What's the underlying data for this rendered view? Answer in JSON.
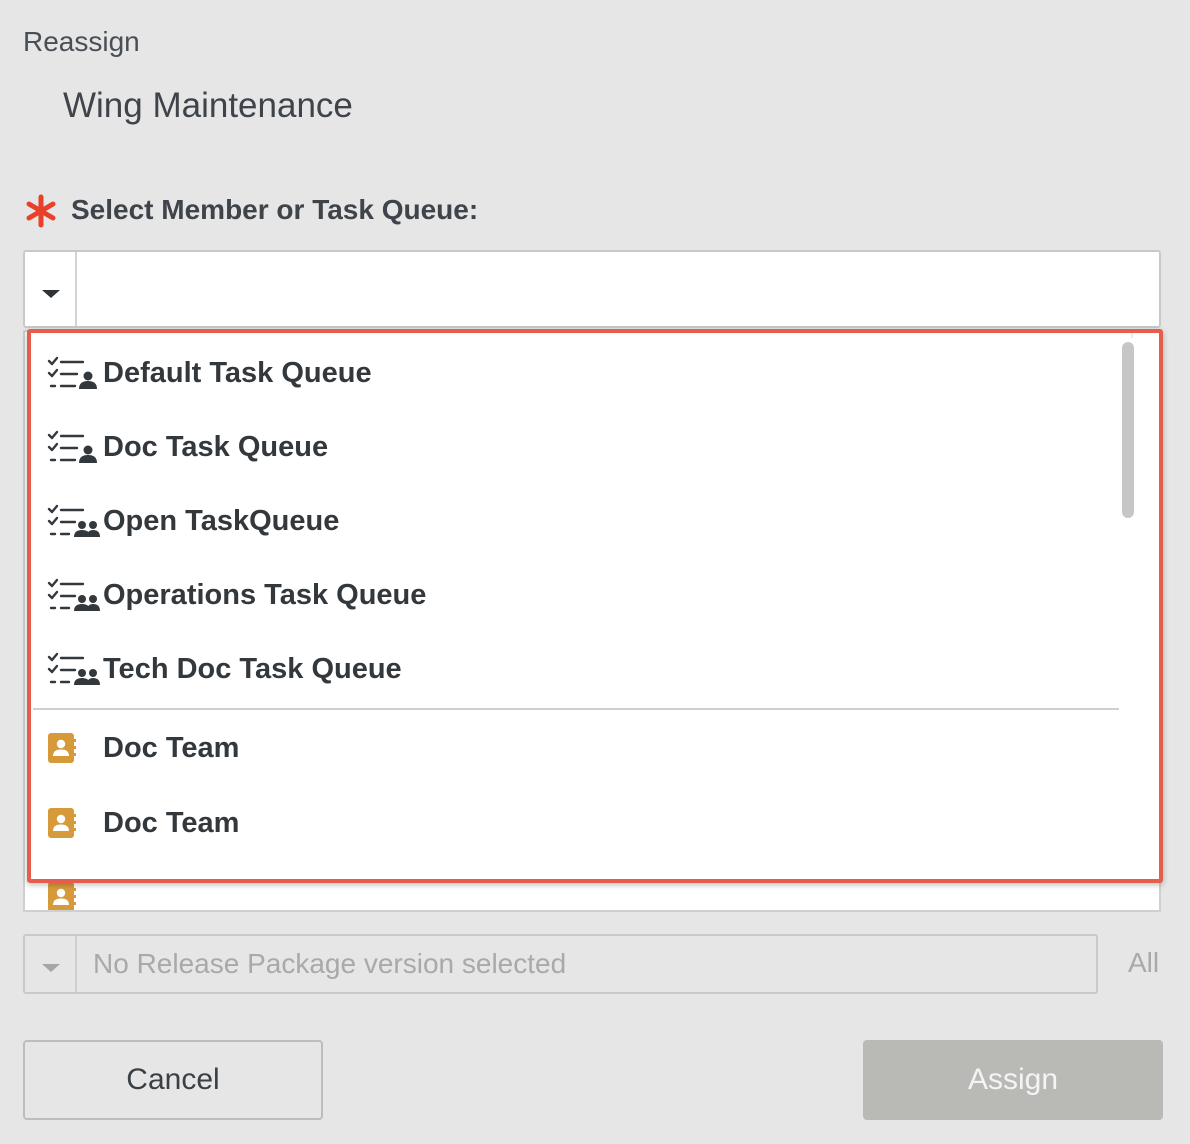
{
  "dialog": {
    "title": "Reassign",
    "item_name": "Wing Maintenance"
  },
  "assignee_field": {
    "required_marker": "*",
    "label": "Select Member or Task Queue:",
    "value": "",
    "accent_color": "#e8412a"
  },
  "dropdown": {
    "task_queues": [
      {
        "label": "Default Task Queue",
        "icon": "task-queue-user-icon"
      },
      {
        "label": "Doc Task Queue",
        "icon": "task-queue-user-icon"
      },
      {
        "label": "Open TaskQueue",
        "icon": "task-queue-group-icon"
      },
      {
        "label": "Operations Task Queue",
        "icon": "task-queue-group-icon"
      },
      {
        "label": "Tech Doc Task Queue",
        "icon": "task-queue-group-icon"
      }
    ],
    "teams": [
      {
        "label": "Doc Team",
        "icon": "team-contact-icon"
      },
      {
        "label": "Doc Team",
        "icon": "team-contact-icon"
      },
      {
        "label": "",
        "icon": "team-contact-icon"
      }
    ],
    "team_icon_color": "#d79a3a",
    "highlight_color": "#e45d4f"
  },
  "version_field": {
    "placeholder": "No Release Package version selected",
    "all_label": "All"
  },
  "buttons": {
    "cancel": "Cancel",
    "assign": "Assign"
  }
}
